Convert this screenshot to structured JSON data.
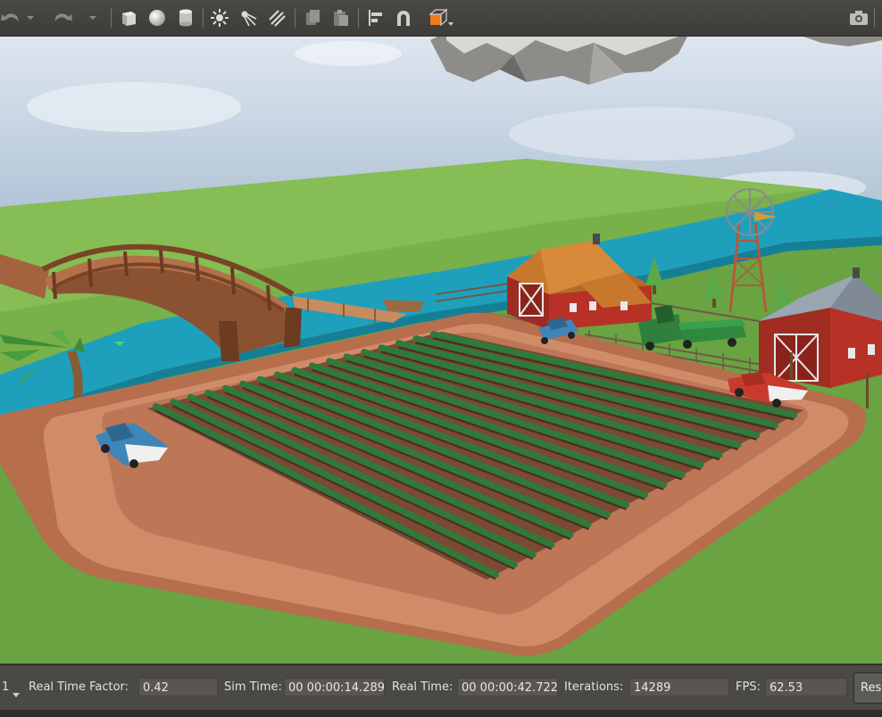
{
  "toolbar": {
    "tools": [
      {
        "name": "undo-icon"
      },
      {
        "name": "undo-menu-icon"
      },
      {
        "name": "redo-icon"
      },
      {
        "name": "redo-menu-icon"
      },
      {
        "name": "box-icon"
      },
      {
        "name": "sphere-icon"
      },
      {
        "name": "cylinder-icon"
      },
      {
        "name": "point-light-icon"
      },
      {
        "name": "spot-light-icon"
      },
      {
        "name": "directional-light-icon"
      },
      {
        "name": "copy-icon"
      },
      {
        "name": "paste-icon"
      },
      {
        "name": "align-icon"
      },
      {
        "name": "snap-icon"
      },
      {
        "name": "view-angle-icon"
      },
      {
        "name": "screenshot-icon"
      }
    ]
  },
  "bottombar": {
    "steps_value": "1",
    "rtf_label": "Real Time Factor:",
    "rtf_value": "0.42",
    "sim_time_label": "Sim Time:",
    "sim_time_value": "00 00:00:14.289",
    "real_time_label": "Real Time:",
    "real_time_value": "00 00:00:42.722",
    "iterations_label": "Iterations:",
    "iterations_value": "14289",
    "fps_label": "FPS:",
    "fps_value": "62.53",
    "reset_label": "Res"
  },
  "colors": {
    "sky": "#c9d7e6",
    "grass": "#6fa845",
    "river": "#1ea0bd",
    "dirt_road": "#c98460",
    "soil": "#7a4a33",
    "crops": "#2f7a3a",
    "barn_red": "#b83126",
    "roof_orange": "#c8782e",
    "roof_gray": "#8b96a3",
    "toolbar_bg": "#3f3e3a"
  }
}
